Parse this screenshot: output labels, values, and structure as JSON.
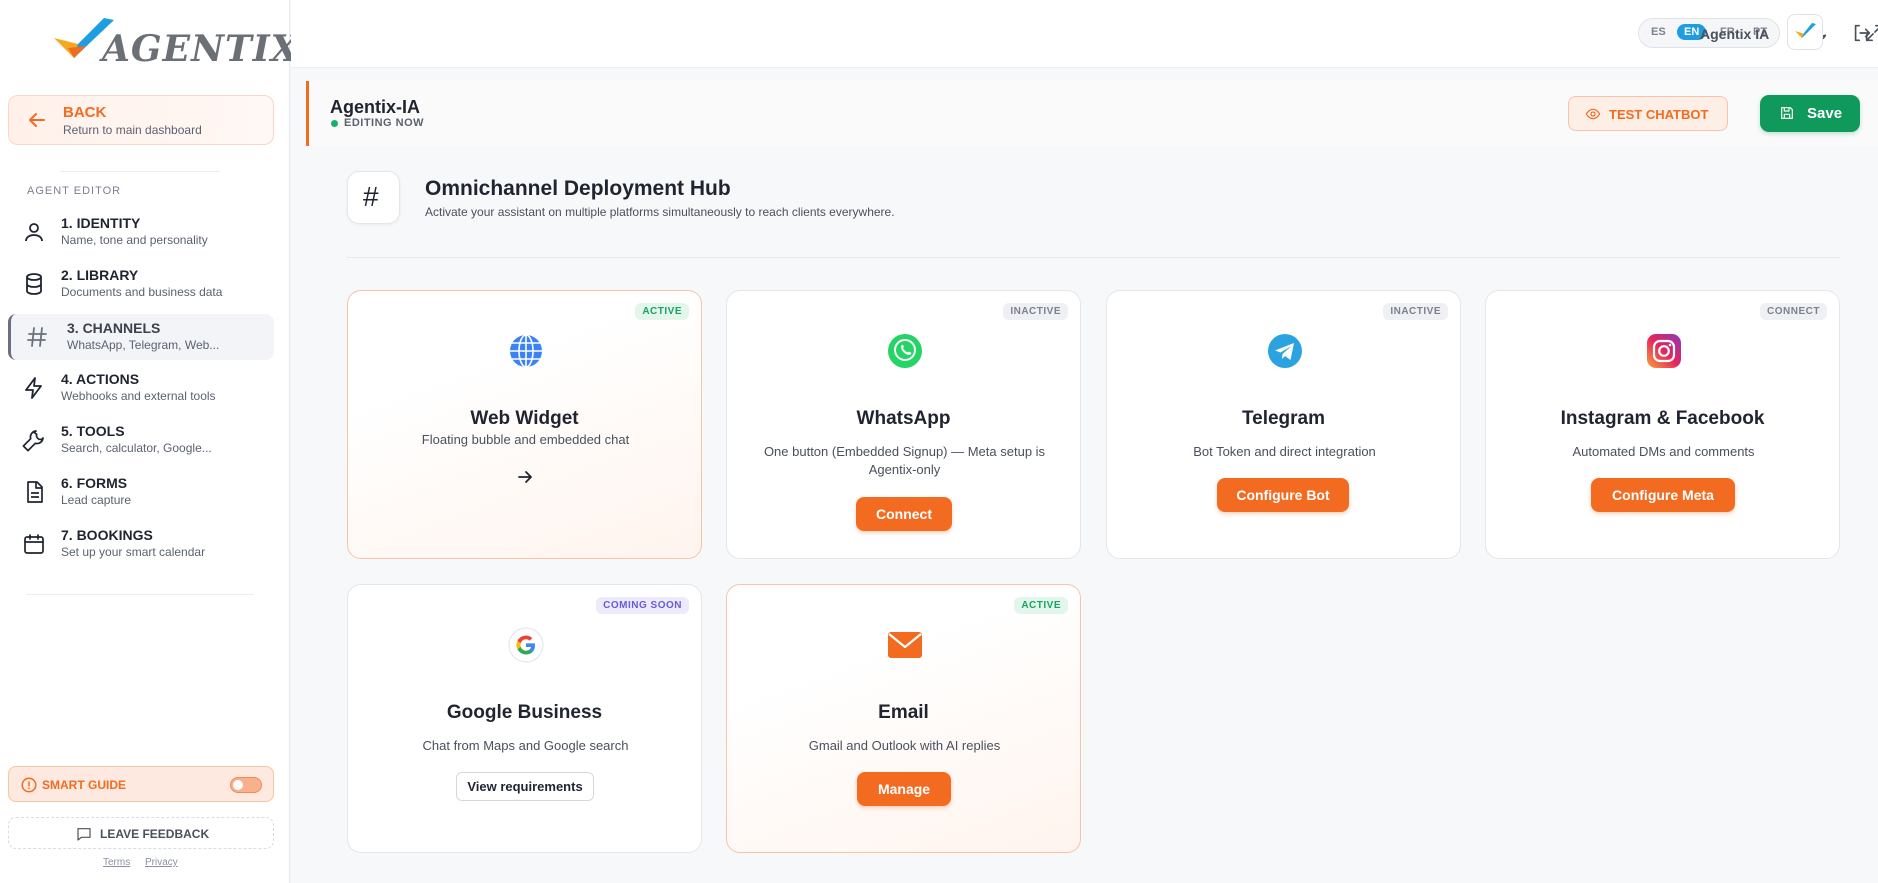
{
  "brand": {
    "logo_text": "AGENTIX",
    "accent": "#f26b21",
    "success": "#0f9a5c"
  },
  "sidebar": {
    "back": {
      "title": "BACK",
      "subtitle": "Return to main dashboard"
    },
    "section_label": "AGENT EDITOR",
    "items": [
      {
        "label": "1. IDENTITY",
        "sub": "Name, tone and personality",
        "icon": "user-icon"
      },
      {
        "label": "2. LIBRARY",
        "sub": "Documents and business data",
        "icon": "database-icon"
      },
      {
        "label": "3. CHANNELS",
        "sub": "WhatsApp, Telegram, Web...",
        "icon": "hash-icon"
      },
      {
        "label": "4. ACTIONS",
        "sub": "Webhooks and external tools",
        "icon": "lightning-icon"
      },
      {
        "label": "5. TOOLS",
        "sub": "Search, calculator, Google...",
        "icon": "wrench-icon"
      },
      {
        "label": "6. FORMS",
        "sub": "Lead capture",
        "icon": "document-icon"
      },
      {
        "label": "7. BOOKINGS",
        "sub": "Set up your smart calendar",
        "icon": "calendar-icon"
      }
    ],
    "smart_guide": "SMART GUIDE",
    "feedback": "LEAVE FEEDBACK",
    "terms": "Terms",
    "privacy": "Privacy"
  },
  "topbar": {
    "languages": [
      "ES",
      "EN",
      "FR",
      "PT"
    ],
    "active_language": "EN",
    "user_name": "Agentix IA"
  },
  "header": {
    "agent_name": "Agentix-IA",
    "status": "EDITING NOW",
    "test_label": "TEST CHATBOT",
    "save_label": "Save"
  },
  "hub": {
    "title": "Omnichannel Deployment Hub",
    "subtitle": "Activate your assistant on multiple platforms simultaneously to reach clients everywhere."
  },
  "channels": [
    {
      "name": "Web Widget",
      "desc": "Floating bubble and embedded chat",
      "badge": "ACTIVE",
      "action": ""
    },
    {
      "name": "WhatsApp",
      "desc": "One button (Embedded Signup) — Meta setup is Agentix-only",
      "badge": "INACTIVE",
      "action": "Connect"
    },
    {
      "name": "Telegram",
      "desc": "Bot Token and direct integration",
      "badge": "INACTIVE",
      "action": "Configure Bot"
    },
    {
      "name": "Instagram & Facebook",
      "desc": "Automated DMs and comments",
      "badge": "CONNECT",
      "action": "Configure Meta"
    },
    {
      "name": "Google Business",
      "desc": "Chat from Maps and Google search",
      "badge": "COMING SOON",
      "action": "View requirements"
    },
    {
      "name": "Email",
      "desc": "Gmail and Outlook with AI replies",
      "badge": "ACTIVE",
      "action": "Manage"
    }
  ]
}
